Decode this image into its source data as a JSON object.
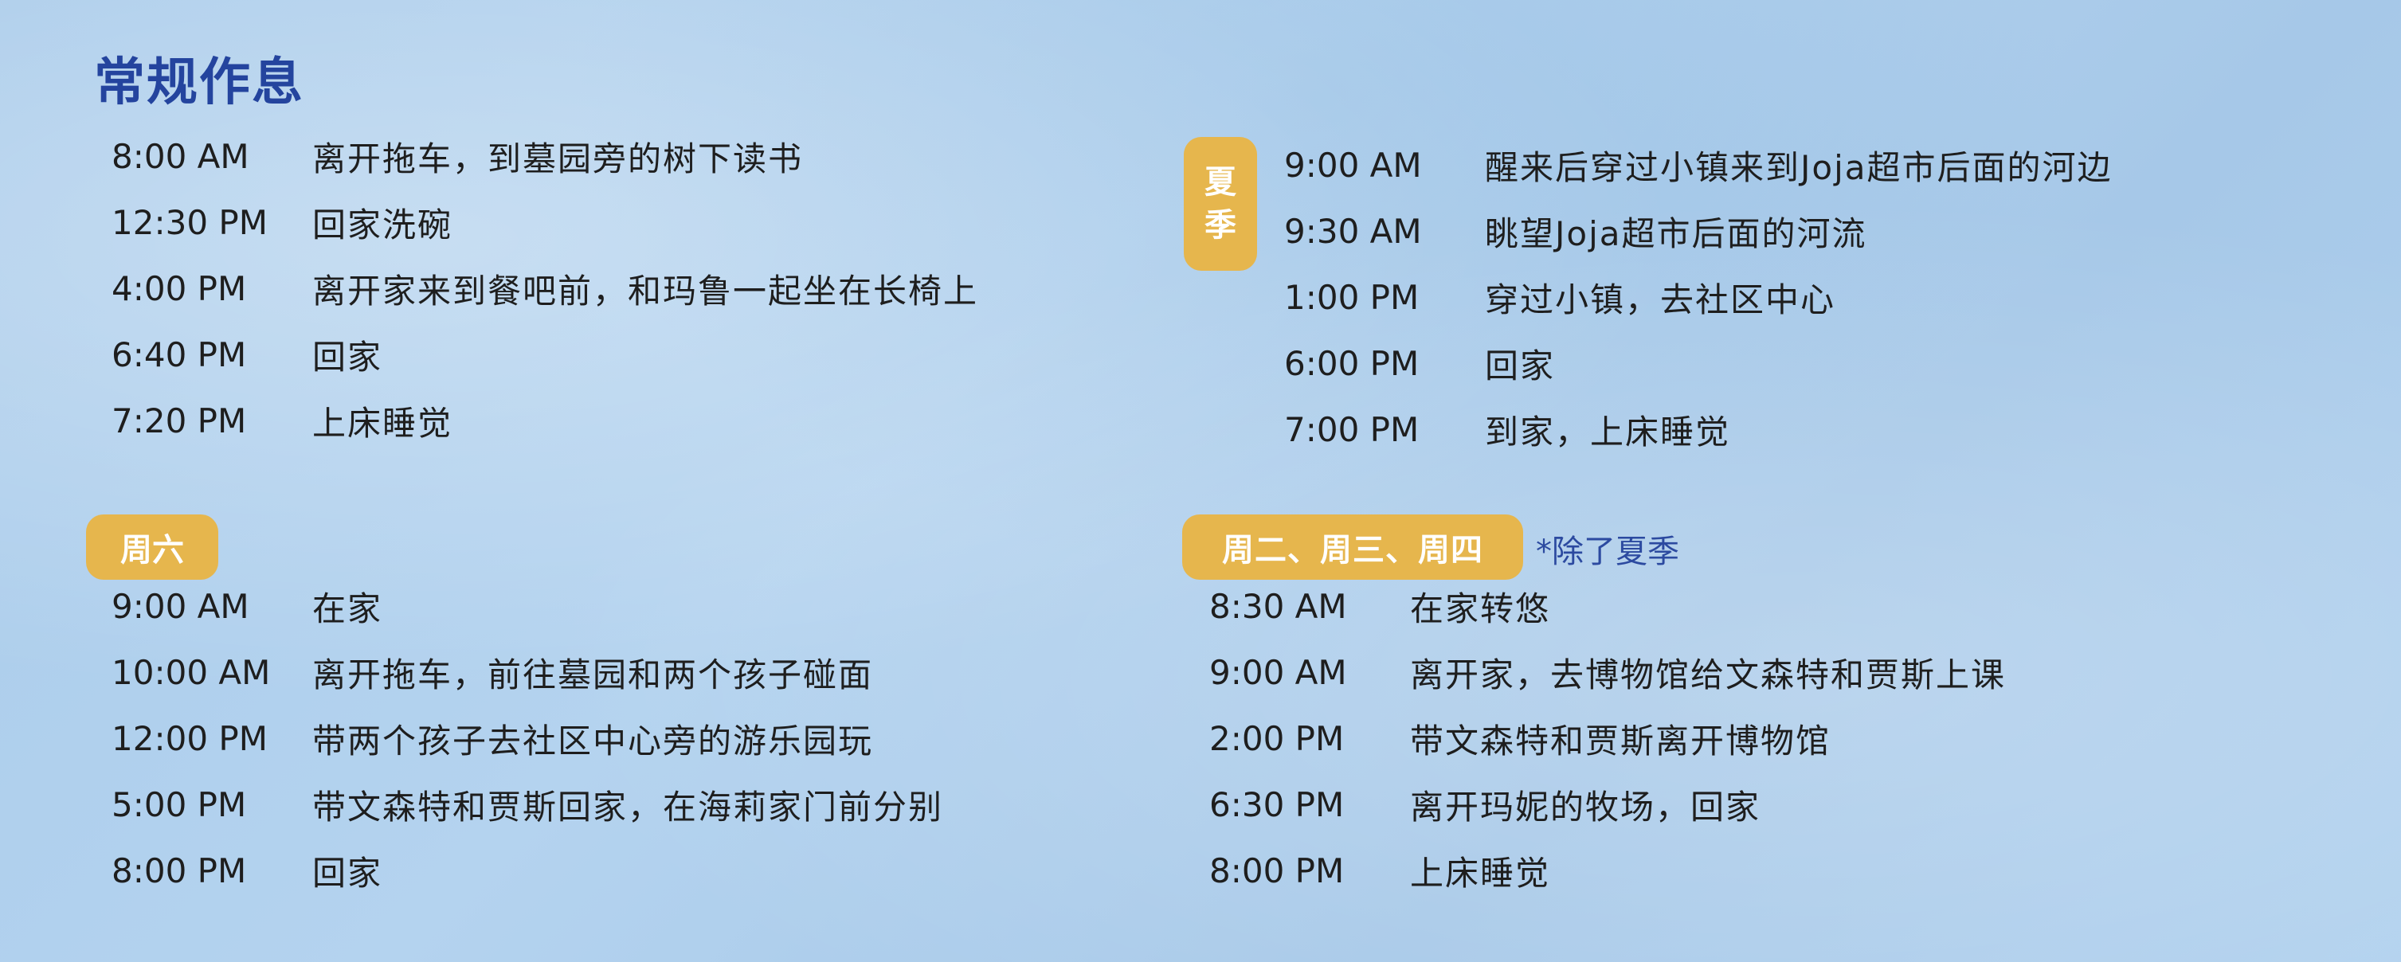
{
  "title": "常规作息",
  "routine": [
    {
      "time": "8:00 AM",
      "activity": "离开拖车，到墓园旁的树下读书"
    },
    {
      "time": "12:30 PM",
      "activity": "回家洗碗"
    },
    {
      "time": "4:00 PM",
      "activity": "离开家来到餐吧前，和玛鲁一起坐在长椅上"
    },
    {
      "time": "6:40 PM",
      "activity": "回家"
    },
    {
      "time": "7:20 PM",
      "activity": "上床睡觉"
    }
  ],
  "saturday": {
    "label": "周六",
    "items": [
      {
        "time": "9:00 AM",
        "activity": "在家"
      },
      {
        "time": "10:00 AM",
        "activity": "离开拖车，前往墓园和两个孩子碰面"
      },
      {
        "time": "12:00 PM",
        "activity": "带两个孩子去社区中心旁的游乐园玩"
      },
      {
        "time": "5:00 PM",
        "activity": "带文森特和贾斯回家，在海莉家门前分别"
      },
      {
        "time": "8:00 PM",
        "activity": "回家"
      }
    ]
  },
  "summer": {
    "label_line1": "夏",
    "label_line2": "季",
    "items": [
      {
        "time": "9:00 AM",
        "activity": "醒来后穿过小镇来到Joja超市后面的河边"
      },
      {
        "time": "9:30 AM",
        "activity": "眺望Joja超市后面的河流"
      },
      {
        "time": "1:00 PM",
        "activity": "穿过小镇，去社区中心"
      },
      {
        "time": "6:00 PM",
        "activity": "回家"
      },
      {
        "time": "7:00 PM",
        "activity": "到家，上床睡觉"
      }
    ]
  },
  "tue_wed_thu": {
    "label": "周二、周三、周四",
    "note": "*除了夏季",
    "items": [
      {
        "time": "8:30 AM",
        "activity": "在家转悠"
      },
      {
        "time": "9:00 AM",
        "activity": "离开家，去博物馆给文森特和贾斯上课"
      },
      {
        "time": "2:00 PM",
        "activity": "带文森特和贾斯离开博物馆"
      },
      {
        "time": "6:30 PM",
        "activity": "离开玛妮的牧场，回家"
      },
      {
        "time": "8:00 PM",
        "activity": "上床睡觉"
      }
    ]
  },
  "colors": {
    "title": "#24449e",
    "badge": "#e6b64d",
    "note": "#2c4aa0",
    "background": "#aecdeb"
  }
}
